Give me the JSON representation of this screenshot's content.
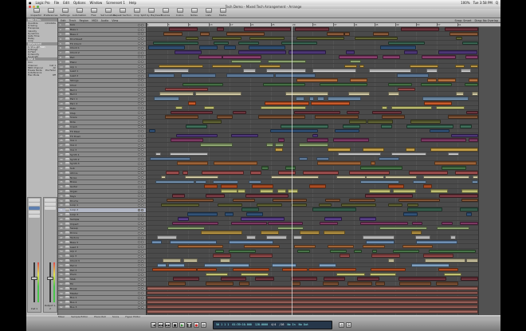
{
  "menubar": {
    "apple": "",
    "items": [
      "Logic Pro",
      "File",
      "Edit",
      "Options",
      "Window",
      "Screenset 1",
      "Help"
    ],
    "right": [
      "100%",
      "Tue 3:58 PM",
      "Q"
    ]
  },
  "window": {
    "title": "Tech Demo - Mixed Tech Arrangement - Arrange"
  },
  "toolbar": {
    "buttons": [
      "Inspector",
      "Preferences",
      "Settings",
      "Automation",
      "Flex",
      "Set Locators",
      "Repeat Section",
      "Crop",
      "Split by Playhead",
      "Bounce",
      "Colors",
      "Notes",
      "Lists",
      "Media"
    ]
  },
  "arrange_strip": {
    "items": [
      "Edit",
      "Track",
      "Region",
      "MIDI",
      "Audio",
      "View",
      "Snap: Smart",
      "Drag: No Overlap"
    ]
  },
  "inspector": {
    "header": "MIDI Thru",
    "rows": [
      [
        "Quantize",
        "1/16-Note"
      ],
      [
        "Q-Swing",
        ""
      ],
      [
        "Transpose",
        ""
      ],
      [
        "Velocity",
        ""
      ],
      [
        "Dynamics",
        ""
      ],
      [
        "Gate Time",
        ""
      ],
      [
        "Delay",
        ""
      ],
      [
        "Loop",
        ""
      ]
    ],
    "section2": "Advanced Quantization",
    "rows2": [
      [
        "Q-Strength",
        ""
      ],
      [
        "Q-Range",
        ""
      ],
      [
        "Q-Flam",
        ""
      ],
      [
        "Q-Velocity",
        ""
      ],
      [
        "Q-Length",
        ""
      ]
    ],
    "section3": "Inst 1",
    "rows3": [
      [
        "Icon",
        ""
      ],
      [
        "Channel",
        "Inst 1"
      ],
      [
        "MIDI Channel",
        "All"
      ],
      [
        "Freeze Mode",
        "Pre Fader"
      ],
      [
        "Q-Reference",
        ""
      ],
      [
        "Flex Mode",
        "Off"
      ]
    ],
    "strips": [
      {
        "name": "Inst 1"
      },
      {
        "name": "Output 1-2"
      }
    ]
  },
  "tracks": [
    "Kick",
    "Bass 1",
    "Bass 2",
    "Drumbeat",
    "FX Chord",
    "Chord 1",
    "Chord 2",
    "Pad",
    "Piano",
    "Arp 1",
    "Lead 1",
    "Lead 2",
    "Strings",
    "Choir",
    "Bell 1",
    "Bell 2",
    "Perc 1",
    "Perc 2",
    "Hats",
    "Clap",
    "Snare",
    "Ride",
    "Crash",
    "FX Riser",
    "FX Down",
    "Vox 1",
    "Vox 2",
    "Vox 3",
    "Synth 1",
    "Synth 2",
    "Synth 3",
    "Sub",
    "Atmos",
    "Noise",
    "Brass",
    "Guitar",
    "Organ",
    "Keys",
    "Drums",
    "Loop 1",
    "Loop 2",
    "Loop 3",
    "Sample",
    "Impact",
    "Sweep",
    "Drone",
    "Texture",
    "Bass 3",
    "Lead 3",
    "Arp 2",
    "Arp 3",
    "Chord 3",
    "Pad 2",
    "Pad 3",
    "Pluck",
    "Stab",
    "Fill",
    "Break",
    "Master",
    "Bus 1",
    "Bus 2",
    "Bus 3"
  ],
  "selected_track": 40,
  "ruler": {
    "bars": [
      "1",
      "5",
      "9",
      "13",
      "17",
      "21",
      "25",
      "29",
      "33",
      "37",
      "41",
      "45",
      "49",
      "53",
      "57",
      "61"
    ]
  },
  "bottombar": {
    "items": [
      "Mixer",
      "Sample Editor",
      "Piano Roll",
      "Score",
      "Hyper Editor"
    ]
  },
  "transport": {
    "position": "50  1  1  1",
    "time": "01:39:10.000",
    "tempo": "128.0000",
    "signature": "4/4",
    "division": "/16",
    "in": "No In",
    "out": "No Out"
  },
  "colors": {
    "accent": "#5e7fb0",
    "playhead": "#eeeeee"
  }
}
